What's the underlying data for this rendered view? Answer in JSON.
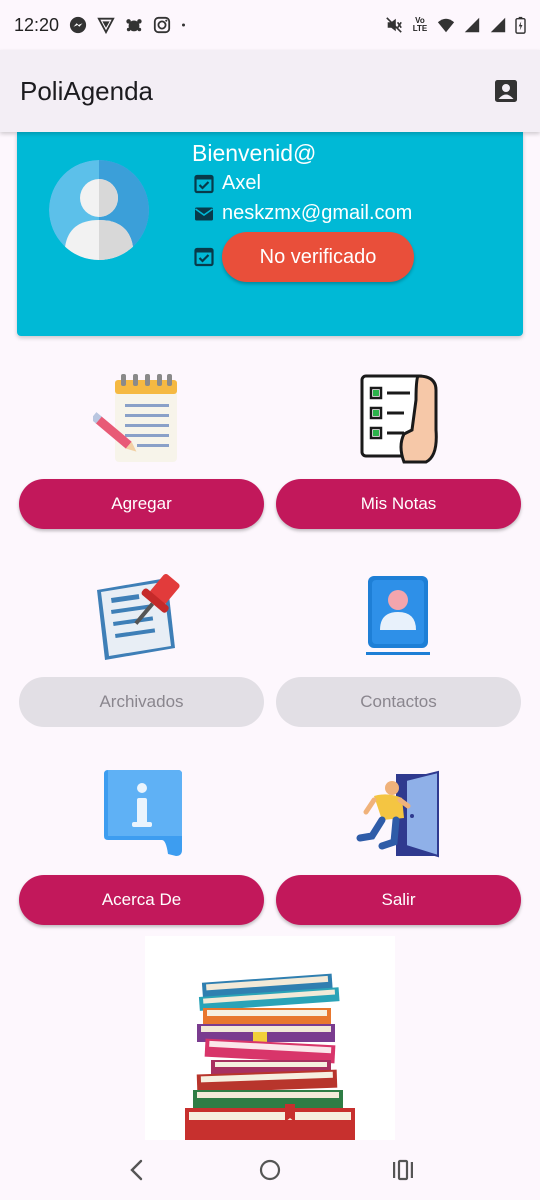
{
  "status_bar": {
    "time": "12:20",
    "left_icons": [
      "messenger-icon",
      "vpn-icon",
      "bug-icon",
      "instagram-icon",
      "dot-icon"
    ],
    "right_icons": [
      "mute-icon",
      "volte-icon",
      "wifi-icon",
      "signal-icon",
      "signal-icon",
      "battery-icon"
    ],
    "volte_label": "Vo LTE"
  },
  "app_bar": {
    "title": "PoliAgenda",
    "profile_icon": "account-box-icon"
  },
  "profile": {
    "welcome": "Bienvenid@",
    "name": "Axel",
    "email": "neskzmx@gmail.com",
    "verify_label": "No verificado",
    "card_color": "#00b9d6",
    "verify_color": "#e94f3a"
  },
  "menu": {
    "add_label": "Agregar",
    "notes_label": "Mis Notas",
    "archived_label": "Archivados",
    "contacts_label": "Contactos",
    "about_label": "Acerca De",
    "exit_label": "Salir",
    "active_color": "#c2185b",
    "disabled_color": "#e2dfe5"
  },
  "nav": {
    "icons": [
      "back-icon",
      "home-icon",
      "recents-icon"
    ]
  }
}
